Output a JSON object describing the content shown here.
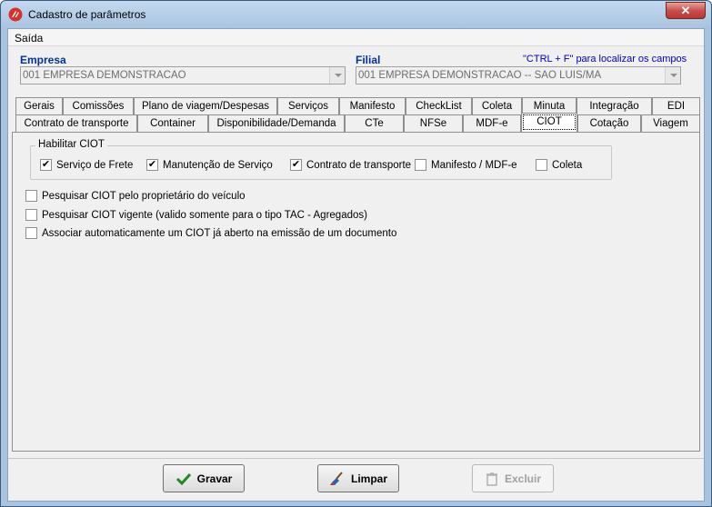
{
  "window": {
    "title": "Cadastro de parâmetros",
    "close_glyph": "✕"
  },
  "menu": {
    "items": [
      {
        "label": "Saída"
      }
    ]
  },
  "empresa": {
    "label": "Empresa",
    "value": "001 EMPRESA DEMONSTRACAO"
  },
  "filial": {
    "label": "Filial",
    "value": "001 EMPRESA DEMONSTRACAO -- SAO LUIS/MA"
  },
  "hint": "\"CTRL + F\" para localizar os campos",
  "tabs_row1": [
    "Gerais",
    "Comissões",
    "Plano de viagem/Despesas",
    "Serviços",
    "Manifesto",
    "CheckList",
    "Coleta",
    "Minuta",
    "Integração",
    "EDI"
  ],
  "tabs_row2": [
    "Contrato de transporte",
    "Container",
    "Disponibilidade/Demanda",
    "CTe",
    "NFSe",
    "MDF-e",
    "CIOT",
    "Cotação",
    "Viagem"
  ],
  "selected_tab": "CIOT",
  "habilitar": {
    "title": "Habilitar CIOT",
    "options": [
      {
        "label": "Serviço de Frete",
        "checked": true
      },
      {
        "label": "Manutenção de Serviço",
        "checked": true
      },
      {
        "label": "Contrato de transporte",
        "checked": true
      },
      {
        "label": "Manifesto / MDF-e",
        "checked": false
      },
      {
        "label": "Coleta",
        "checked": false
      }
    ]
  },
  "options": [
    {
      "label": "Pesquisar CIOT pelo proprietário do veículo",
      "checked": false
    },
    {
      "label": "Pesquisar CIOT vigente (valido somente para o tipo TAC - Agregados)",
      "checked": false
    },
    {
      "label": "Associar automaticamente um CIOT já aberto na emissão de um documento",
      "checked": false
    }
  ],
  "buttons": {
    "gravar": "Gravar",
    "limpar": "Limpar",
    "excluir": "Excluir"
  },
  "icons": {
    "app": "app-logo-icon",
    "gravar": "check-icon",
    "limpar": "broom-icon",
    "excluir": "trash-icon"
  },
  "colors": {
    "label_blue": "#003399",
    "hint_blue": "#0000c0",
    "titlebar": "#a9c4e0"
  }
}
